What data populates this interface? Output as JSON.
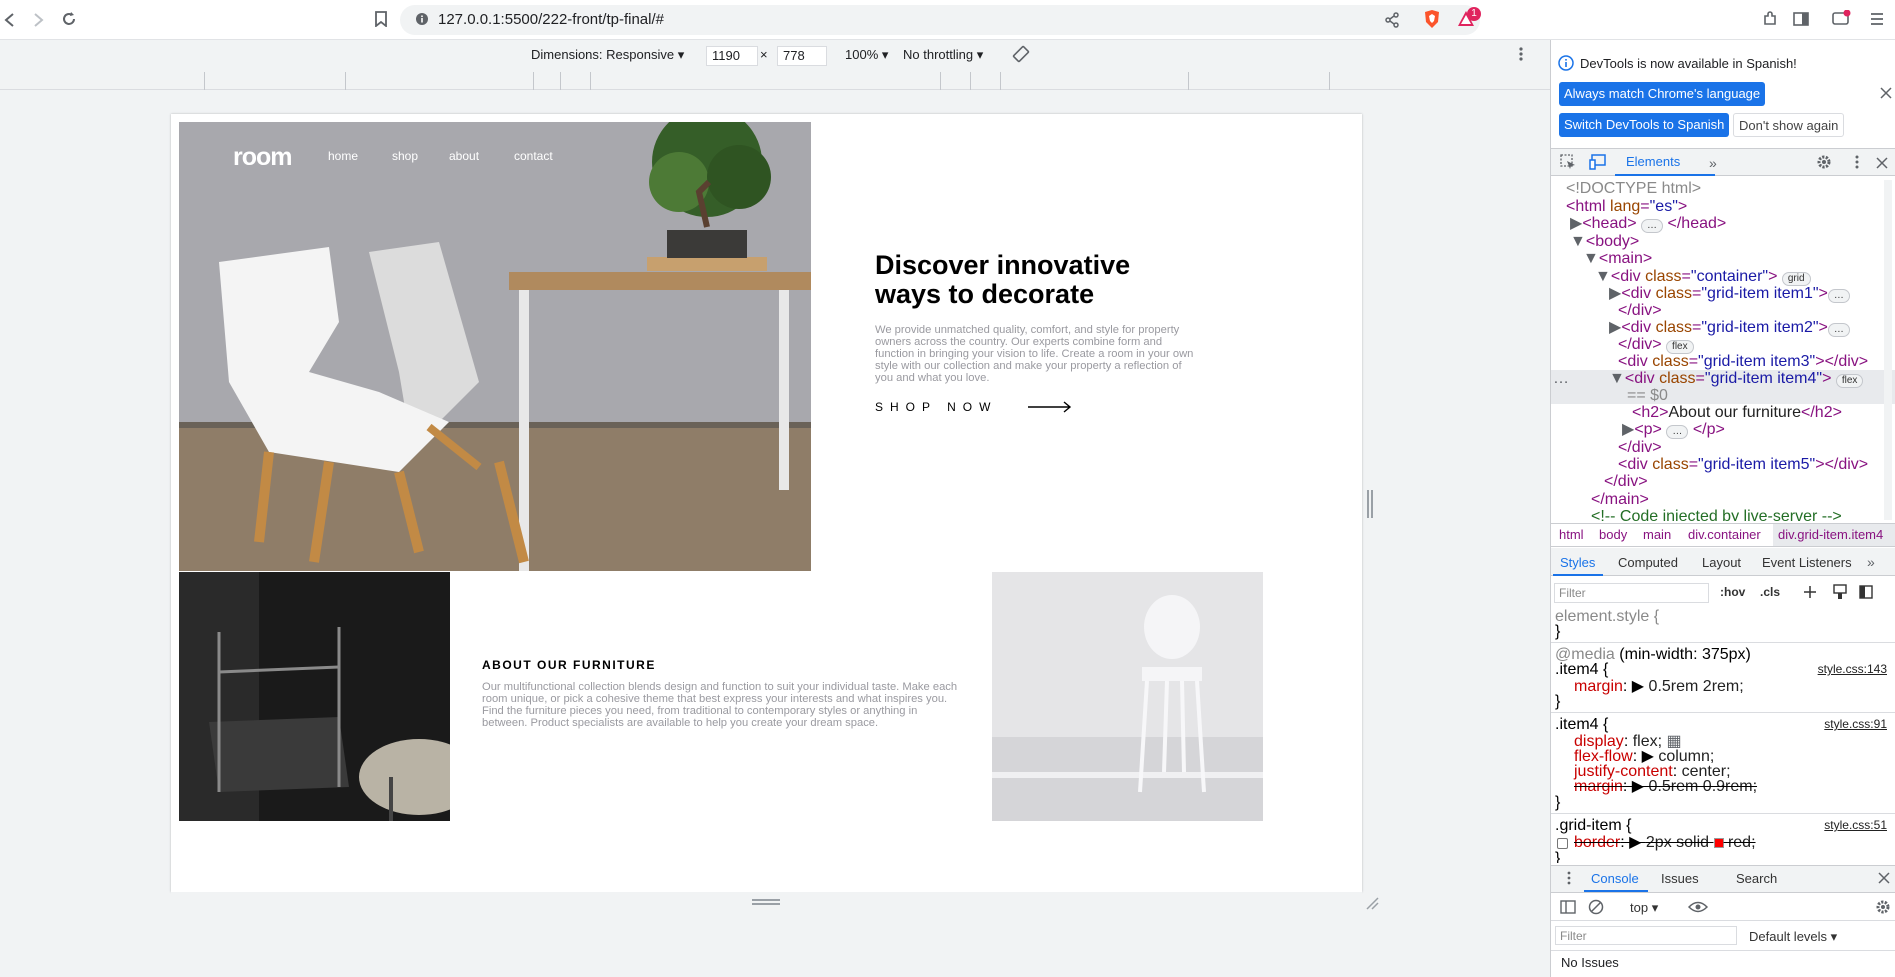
{
  "browser": {
    "url": "127.0.0.1:5500/222-front/tp-final/#",
    "notification_count": "1"
  },
  "device_toolbar": {
    "dimensions_label": "Dimensions: Responsive",
    "width": "1190",
    "times": "×",
    "height": "778",
    "zoom": "100%",
    "throttling": "No throttling"
  },
  "page": {
    "brand": "room",
    "nav": [
      "home",
      "shop",
      "about",
      "contact"
    ],
    "headline": "Discover innovative ways to decorate",
    "lead": "We provide unmatched quality, comfort, and style for property owners across the country. Our experts combine form and function in bringing your vision to life. Create a room in your own style with our collection and make your property a reflection of you and what you love.",
    "shop_now": "SHOP NOW",
    "about_title": "ABOUT OUR FURNITURE",
    "about_text": "Our multifunctional collection blends design and function to suit your individual taste. Make each room unique, or pick a cohesive theme that best express your interests and what inspires you. Find the furniture pieces you need, from traditional to contemporary styles or anything in between. Product specialists are available to help you create your dream space."
  },
  "devtools": {
    "info_message": "DevTools is now available in Spanish!",
    "btn_match": "Always match Chrome's language",
    "btn_switch": "Switch DevTools to Spanish",
    "btn_dont_show": "Don't show again",
    "tab_elements": "Elements",
    "dom": {
      "doctype": "<!DOCTYPE html>",
      "html_open": "<html ",
      "html_attr": "lang",
      "html_val": "\"es\"",
      "head": "<head>",
      "head_close": "</head>",
      "body": "<body>",
      "main": "<main>",
      "div": "<div ",
      "class_attr": "class",
      "container_val": "\"container\"",
      "grid_badge": "grid",
      "item1_val": "\"grid-item item1\"",
      "div_close": "</div>",
      "item2_val": "\"grid-item item2\"",
      "flex_badge": "flex",
      "item3_val": "\"grid-item item3\"",
      "item4_val": "\"grid-item item4\"",
      "eq": "== $0",
      "h2_open": "<h2>",
      "h2_text": "About our furniture",
      "h2_close": "</h2>",
      "p_open": "<p>",
      "p_close": "</p>",
      "item5_val": "\"grid-item item5\"",
      "main_close": "</main>",
      "comment": "<!-- Code injected by live-server -->"
    },
    "breadcrumbs": [
      "html",
      "body",
      "main",
      "div.container",
      "div.grid-item.item4"
    ],
    "styles_tabs": [
      "Styles",
      "Computed",
      "Layout",
      "Event Listeners"
    ],
    "filter_placeholder": "Filter",
    "hov": ":hov",
    "cls": ".cls",
    "styles": {
      "element_style": "element.style {",
      "close": "}",
      "media": "@media",
      "media_query": "(min-width: 375px)",
      "item4_sel": ".item4 {",
      "src1": "style.css:143",
      "margin_prop": "margin",
      "margin_val1": "0.5rem 2rem;",
      "src2": "style.css:91",
      "display_prop": "display",
      "display_val": "flex;",
      "flexflow_prop": "flex-flow",
      "flexflow_val": "column;",
      "justify_prop": "justify-content",
      "justify_val": "center;",
      "margin_val2": "0.5rem 0.9rem;",
      "grid_sel": ".grid-item {",
      "src3": "style.css:51",
      "border_prop": "border",
      "border_val1": "2px solid",
      "border_val2": "red;"
    },
    "console_tabs": [
      "Console",
      "Issues",
      "Search"
    ],
    "context": "top",
    "console_filter": "Filter",
    "default_levels": "Default levels",
    "no_issues": "No Issues"
  },
  "colors": {
    "accent": "#1a73e8",
    "tag": "#881280",
    "attr": "#994500"
  }
}
